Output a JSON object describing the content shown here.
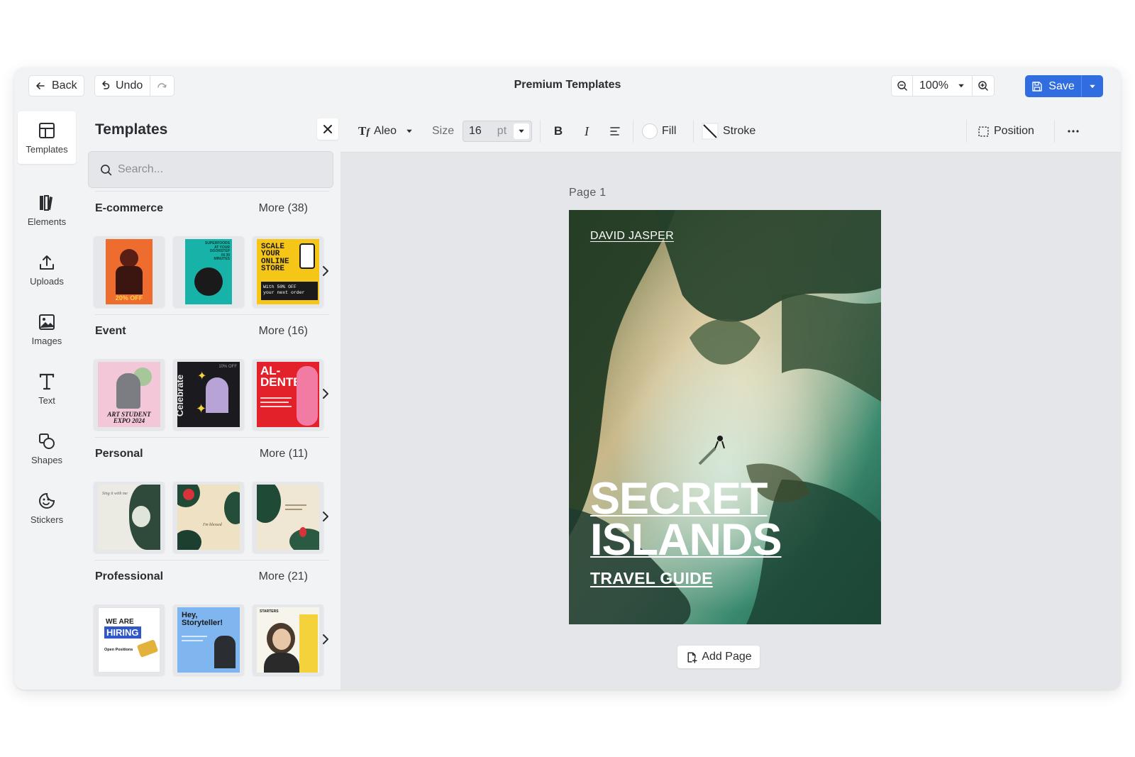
{
  "topbar": {
    "back_label": "Back",
    "undo_label": "Undo",
    "title": "Premium Templates",
    "zoom": "100%",
    "save_label": "Save"
  },
  "rail": {
    "items": [
      {
        "label": "Templates",
        "icon": "layout-icon"
      },
      {
        "label": "Elements",
        "icon": "books-icon"
      },
      {
        "label": "Uploads",
        "icon": "upload-icon"
      },
      {
        "label": "Images",
        "icon": "image-icon"
      },
      {
        "label": "Text",
        "icon": "text-icon"
      },
      {
        "label": "Shapes",
        "icon": "shapes-icon"
      },
      {
        "label": "Stickers",
        "icon": "sticker-icon"
      }
    ]
  },
  "panel": {
    "title": "Templates",
    "search_placeholder": "Search...",
    "sections": [
      {
        "name": "E-commerce",
        "more": "More (38)",
        "thumbs": [
          {
            "lines": [
              "20% OFF"
            ],
            "bg": "#ef6c2f"
          },
          {
            "lines": [
              "SUPERFOODS",
              "AT YOUR",
              "DOORSTEP",
              "IN 30",
              "MINUTES"
            ],
            "bg": "#17b3a8"
          },
          {
            "lines": [
              "SCALE",
              "YOUR",
              "ONLINE",
              "STORE",
              "With 50% OFF",
              "your next order"
            ],
            "bg": "#f5c518"
          }
        ]
      },
      {
        "name": "Event",
        "more": "More (16)",
        "thumbs": [
          {
            "lines": [
              "ART STUDENT",
              "EXPO 2024"
            ],
            "bg": "#f3c6d8"
          },
          {
            "lines": [
              "Celebrate",
              "10% OFF"
            ],
            "bg": "#1b1b1f"
          },
          {
            "lines": [
              "AL-",
              "DENTE"
            ],
            "bg": "#e3212b"
          }
        ]
      },
      {
        "name": "Personal",
        "more": "More (11)",
        "thumbs": [
          {
            "lines": [
              "Sing it with me"
            ],
            "bg": "#ecebe3"
          },
          {
            "lines": [
              "I'm blessed"
            ],
            "bg": "#efe1c4"
          },
          {
            "lines": [],
            "bg": "#f0e6d4"
          }
        ]
      },
      {
        "name": "Professional",
        "more": "More (21)",
        "thumbs": [
          {
            "lines": [
              "WE ARE",
              "HIRING",
              "Open Positions"
            ],
            "bg": "#ffffff"
          },
          {
            "lines": [
              "Hey,",
              "Storyteller!"
            ],
            "bg": "#7fb6f0"
          },
          {
            "lines": [
              "STARTERS"
            ],
            "bg": "#f7f4ec"
          }
        ]
      }
    ]
  },
  "toolbar": {
    "font": "Aleo",
    "size_label": "Size",
    "size_value": "16",
    "size_unit": "pt",
    "fill_label": "Fill",
    "stroke_label": "Stroke",
    "position_label": "Position"
  },
  "canvas": {
    "page_label": "Page  1",
    "author": "DAVID JASPER",
    "title_line1": "SECRET",
    "title_line2": "ISLANDS",
    "subtitle": "TRAVEL GUIDE",
    "add_page_label": "Add Page"
  },
  "colors": {
    "accent": "#2f6de0",
    "panel_bg": "#f2f3f5",
    "workspace_bg": "#e4e6e9"
  }
}
